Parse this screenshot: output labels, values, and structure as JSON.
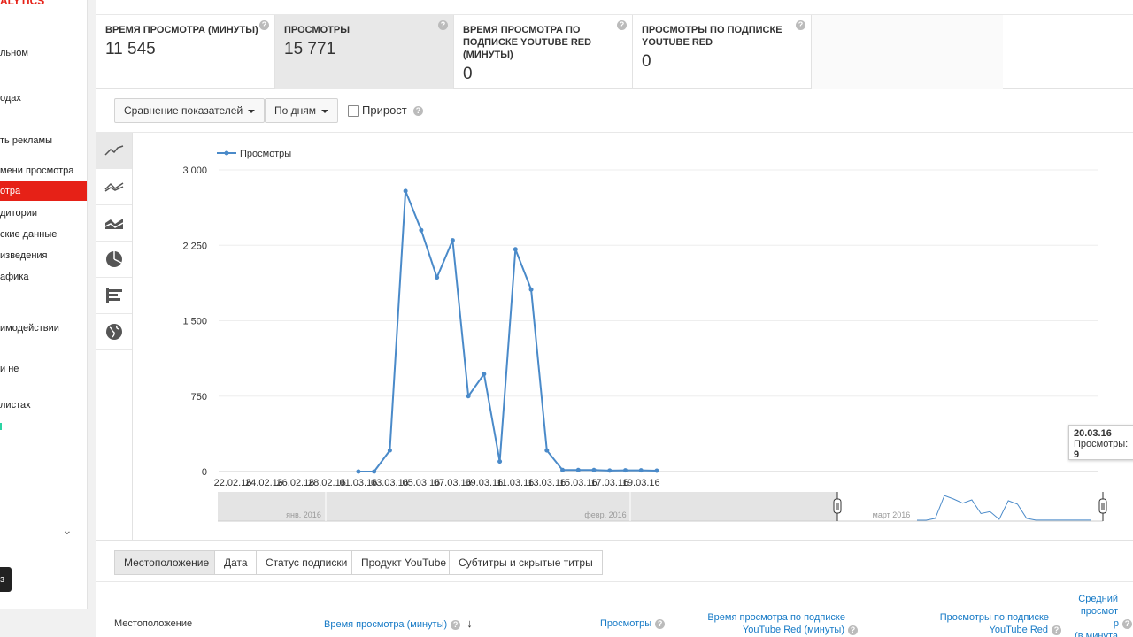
{
  "sidebar": {
    "brand": "ALYTICS",
    "items": [
      {
        "label": "льном",
        "active": false
      },
      {
        "label": "одах",
        "active": false
      },
      {
        "label": "ть рекламы",
        "active": false
      },
      {
        "label": "мени просмотра",
        "active": false
      },
      {
        "label": "отра",
        "active": true
      },
      {
        "label": "дитории",
        "active": false
      },
      {
        "label": "ские данные",
        "active": false
      },
      {
        "label": "изведения",
        "active": false
      },
      {
        "label": "афика",
        "active": false
      },
      {
        "label": "имодействии",
        "active": false
      },
      {
        "label": "и не",
        "active": false
      },
      {
        "label": "листах",
        "active": false
      }
    ],
    "chevron": "⌄",
    "black_button": "з"
  },
  "metrics": [
    {
      "label": "ВРЕМЯ ПРОСМОТРА (МИНУТЫ)",
      "value": "11 545",
      "selected": false
    },
    {
      "label": "ПРОСМОТРЫ",
      "value": "15 771",
      "selected": true
    },
    {
      "label": "ВРЕМЯ ПРОСМОТРА ПО ПОДПИСКЕ YOUTUBE RED (МИНУТЫ)",
      "value": "0",
      "selected": false
    },
    {
      "label": "ПРОСМОТРЫ ПО ПОДПИСКЕ YOUTUBE RED",
      "value": "0",
      "selected": false
    }
  ],
  "help_glyph": "?",
  "controls": {
    "compare_label": "Сравнение показателей",
    "period_label": "По дням",
    "growth_label": "Прирост",
    "growth_checked": false
  },
  "chart_types": [
    "line-chart-icon",
    "multiline-chart-icon",
    "stacked-area-icon",
    "pie-chart-icon",
    "bar-chart-icon",
    "globe-map-icon"
  ],
  "chart_data": {
    "type": "line",
    "title": "",
    "xlabel": "",
    "ylabel": "",
    "legend": "Просмотры",
    "legend_position": "top-left",
    "color": "#4a8ac9",
    "ylim": [
      0,
      3000
    ],
    "y_ticks": [
      "0",
      "750",
      "1 500",
      "2 250",
      "3 000"
    ],
    "x_tick_labels": [
      "22.02.16",
      "24.02.16",
      "26.02.16",
      "28.02.16",
      "01.03.16",
      "03.03.16",
      "05.03.16",
      "07.03.16",
      "09.03.16",
      "11.03.16",
      "13.03.16",
      "15.03.16",
      "17.03.16",
      "19.03.16"
    ],
    "x": [
      "01.03.16",
      "02.03.16",
      "03.03.16",
      "04.03.16",
      "05.03.16",
      "06.03.16",
      "07.03.16",
      "08.03.16",
      "09.03.16",
      "10.03.16",
      "11.03.16",
      "12.03.16",
      "13.03.16",
      "14.03.16",
      "15.03.16",
      "16.03.16",
      "17.03.16",
      "18.03.16",
      "19.03.16",
      "20.03.16"
    ],
    "series": [
      {
        "name": "Просмотры",
        "values": [
          0,
          0,
          210,
          2790,
          2400,
          1930,
          2300,
          750,
          970,
          100,
          2210,
          1810,
          210,
          15,
          15,
          15,
          10,
          12,
          12,
          9
        ]
      }
    ],
    "grid": true
  },
  "tooltip": {
    "date": "20.03.16",
    "label": "Просмотры:",
    "value": "9"
  },
  "navigator": {
    "labels": [
      "янв. 2016",
      "февр. 2016",
      "март 2016"
    ]
  },
  "dimension_tabs": [
    {
      "label": "Местоположение",
      "selected": true
    },
    {
      "label": "Дата",
      "selected": false
    },
    {
      "label": "Статус подписки",
      "selected": false
    },
    {
      "label": "Продукт YouTube",
      "selected": false
    },
    {
      "label": "Субтитры и скрытые титры",
      "selected": false
    }
  ],
  "table": {
    "headers": {
      "location": "Местоположение",
      "watch_time": "Время просмотра (минуты)",
      "sort_arrow": "↓",
      "views": "Просмотры",
      "red_watch_1": "Время просмотра по подписке",
      "red_watch_2": "YouTube Red (минуты)",
      "red_views_1": "Просмотры по подписке",
      "red_views_2": "YouTube Red",
      "avg_1": "Средний",
      "avg_2": "просмот",
      "avg_3": "р",
      "avg_4": "(в минута"
    }
  }
}
